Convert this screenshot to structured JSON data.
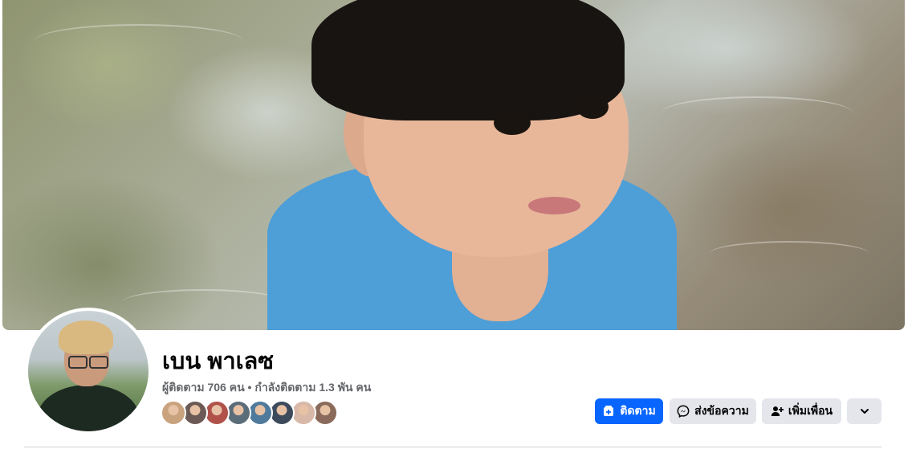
{
  "profile": {
    "name": "เบน พาเลซ",
    "followers_text": "ผู้ติดตาม 706 คน",
    "separator": "•",
    "following_text": "กำลังติดตาม 1.3 พัน คน"
  },
  "mutual_friends": [
    {
      "color": "#c9a27e"
    },
    {
      "color": "#6b5a55"
    },
    {
      "color": "#b0524a"
    },
    {
      "color": "#5c6d7a"
    },
    {
      "color": "#4f7a9c"
    },
    {
      "color": "#3d4a5c"
    },
    {
      "color": "#d8b8a8"
    },
    {
      "color": "#8a6a5a"
    }
  ],
  "actions": {
    "follow_label": "ติดตาม",
    "message_label": "ส่งข้อความ",
    "add_friend_label": "เพิ่มเพื่อน"
  },
  "icons": {
    "follow": "follow-icon",
    "message": "messenger-icon",
    "add_friend": "add-friend-icon",
    "more": "chevron-down-icon"
  },
  "colors": {
    "accent": "#0866ff",
    "secondary_button": "#e4e6eb",
    "muted_text": "#65676b"
  }
}
